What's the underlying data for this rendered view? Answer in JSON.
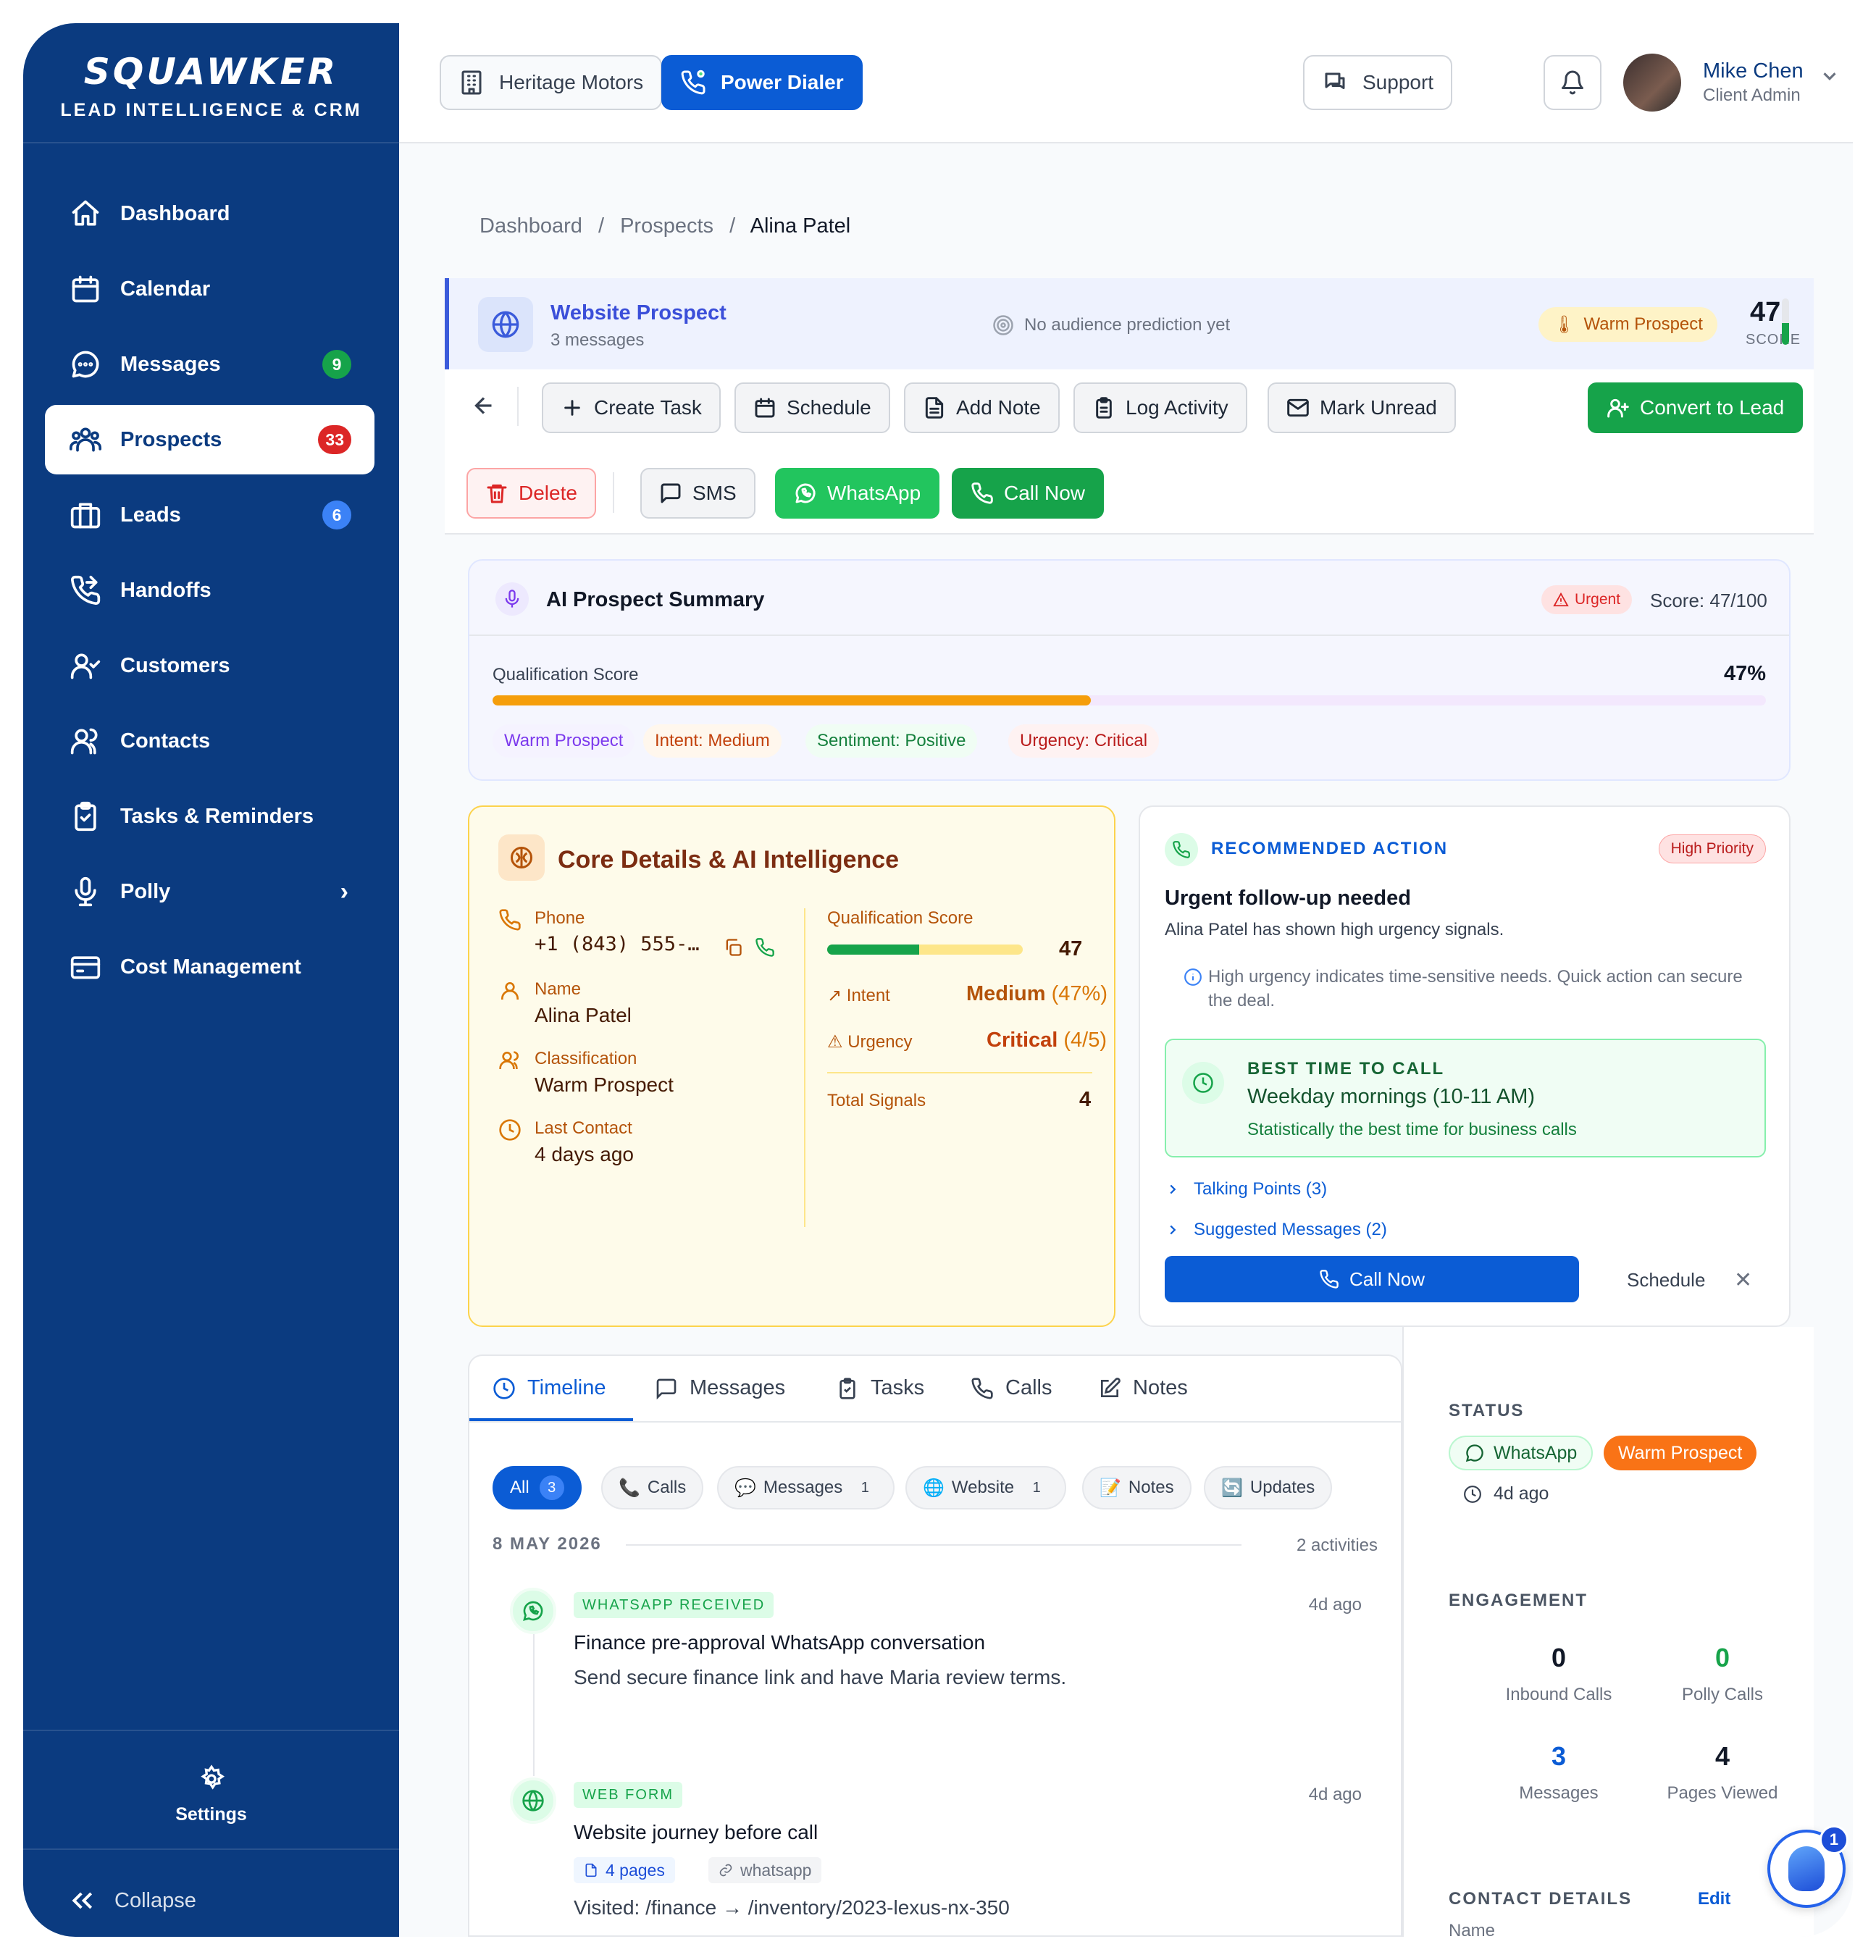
{
  "brand": {
    "logo": "SQUAWKER",
    "subtitle": "LEAD INTELLIGENCE & CRM"
  },
  "nav": {
    "items": [
      {
        "label": "Dashboard",
        "icon": "home-icon"
      },
      {
        "label": "Calendar",
        "icon": "calendar-icon"
      },
      {
        "label": "Messages",
        "icon": "chat-icon",
        "badge": "9",
        "badge_color": "#16a34a"
      },
      {
        "label": "Prospects",
        "icon": "users-icon",
        "badge": "33",
        "badge_color": "#dc2626",
        "active": true
      },
      {
        "label": "Leads",
        "icon": "briefcase-icon",
        "badge": "6",
        "badge_color": "#3b82f6"
      },
      {
        "label": "Handoffs",
        "icon": "phone-forward-icon"
      },
      {
        "label": "Customers",
        "icon": "user-check-icon"
      },
      {
        "label": "Contacts",
        "icon": "contacts-icon"
      },
      {
        "label": "Tasks & Reminders",
        "icon": "clipboard-icon"
      },
      {
        "label": "Polly",
        "icon": "mic-icon"
      },
      {
        "label": "Cost Management",
        "icon": "wallet-icon"
      }
    ],
    "settings_label": "Settings",
    "collapse_label": "Collapse"
  },
  "header": {
    "dealer": "Heritage Motors",
    "dialer": "Power Dialer",
    "support": "Support",
    "user_name": "Mike Chen",
    "user_role": "Client Admin"
  },
  "breadcrumb": {
    "home": "Dashboard",
    "section": "Prospects",
    "current": "Alina Patel",
    "sep": "/"
  },
  "prospect": {
    "title": "Website Prospect",
    "messages": "3 messages",
    "prediction": "No audience prediction yet",
    "classification": "Warm Prospect",
    "score": "47",
    "score_label": "SCORE",
    "score_fraction": 0.47
  },
  "actions": {
    "create_task": "Create Task",
    "schedule": "Schedule",
    "add_note": "Add Note",
    "log_activity": "Log Activity",
    "mark_unread": "Mark Unread",
    "convert": "Convert to Lead",
    "delete": "Delete",
    "sms": "SMS",
    "whatsapp": "WhatsApp",
    "call_now": "Call Now"
  },
  "ai_summary": {
    "title": "AI Prospect Summary",
    "urgency_badge": "Urgent",
    "score_text": "Score: 47/100",
    "qual_label": "Qualification Score",
    "qual_value": "47%",
    "qual_fraction": 0.47,
    "tags": [
      "Warm Prospect",
      "Intent: Medium",
      "Sentiment: Positive",
      "Urgency: Critical"
    ]
  },
  "core": {
    "title": "Core Details & AI Intelligence",
    "phone_label": "Phone",
    "phone_value": "+1 (843) 555-…",
    "name_label": "Name",
    "name_value": "Alina Patel",
    "class_label": "Classification",
    "class_value": "Warm Prospect",
    "last_label": "Last Contact",
    "last_value": "4 days ago",
    "qs_label": "Qualification Score",
    "qs_value": "47",
    "intent_label": "Intent",
    "intent_value": "Medium",
    "intent_pct": "(47%)",
    "urgency_label": "Urgency",
    "urgency_value": "Critical",
    "urgency_scale": "(4/5)",
    "signals_label": "Total Signals",
    "signals_value": "4"
  },
  "recommended": {
    "title": "RECOMMENDED ACTION",
    "priority": "High Priority",
    "headline": "Urgent follow-up needed",
    "desc": "Alina Patel has shown high urgency signals.",
    "note": "High urgency indicates time-sensitive needs. Quick action can secure the deal.",
    "btc_label": "BEST TIME TO CALL",
    "btc_time": "Weekday mornings (10-11 AM)",
    "btc_sub": "Statistically the best time for business calls",
    "talking_points": "Talking Points (3)",
    "suggested": "Suggested Messages (2)",
    "call_now": "Call Now",
    "schedule": "Schedule"
  },
  "timeline": {
    "tabs": [
      "Timeline",
      "Messages",
      "Tasks",
      "Calls",
      "Notes"
    ],
    "filters": [
      {
        "label": "All",
        "count": "3"
      },
      {
        "label": "Calls"
      },
      {
        "label": "Messages",
        "count": "1"
      },
      {
        "label": "Website",
        "count": "1"
      },
      {
        "label": "Notes"
      },
      {
        "label": "Updates"
      }
    ],
    "date": "8 MAY 2026",
    "activity_count": "2 activities",
    "events": [
      {
        "tag": "WHATSAPP RECEIVED",
        "ago": "4d ago",
        "title": "Finance pre-approval WhatsApp conversation",
        "body": "Send secure finance link and have Maria review terms."
      },
      {
        "tag": "WEB FORM",
        "ago": "4d ago",
        "title": "Website journey before call",
        "pages": "4 pages",
        "source": "whatsapp",
        "body": "Visited: /finance → /inventory/2023-lexus-nx-350"
      }
    ]
  },
  "side": {
    "status_h": "STATUS",
    "channel": "WhatsApp",
    "classification": "Warm Prospect",
    "ago": "4d ago",
    "engagement_h": "ENGAGEMENT",
    "inbound_calls": "0",
    "inbound_label": "Inbound Calls",
    "polly_calls": "0",
    "polly_label": "Polly Calls",
    "messages": "3",
    "messages_label": "Messages",
    "pages": "4",
    "pages_label": "Pages Viewed",
    "contact_h": "CONTACT DETAILS",
    "edit": "Edit",
    "name_label": "Name"
  },
  "polly_badge": "1",
  "colors": {
    "primary": "#0b3b80",
    "accent": "#0b5cd5",
    "success": "#16a34a",
    "warning": "#f59e0b",
    "danger": "#dc2626"
  }
}
